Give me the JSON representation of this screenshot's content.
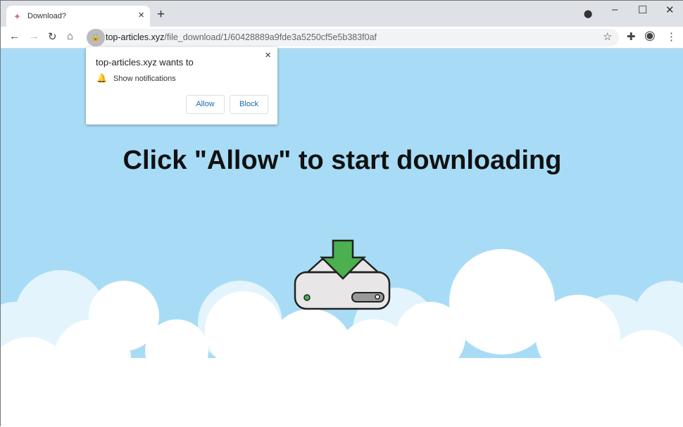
{
  "tab": {
    "title": "Download?",
    "favicon": "puzzle-favicon"
  },
  "address": {
    "domain": "top-articles.xyz",
    "path": "/file_download/1/60428889a9fde3a5250cf5e5b383f0af"
  },
  "popup": {
    "title": "top-articles.xyz wants to",
    "permission": "Show notifications",
    "allow": "Allow",
    "block": "Block"
  },
  "page": {
    "headline": "Click \"Allow\" to start downloading"
  },
  "colors": {
    "sky": "#a8dcf6",
    "arrow": "#4caf50",
    "drive": "#e8e6e6"
  }
}
